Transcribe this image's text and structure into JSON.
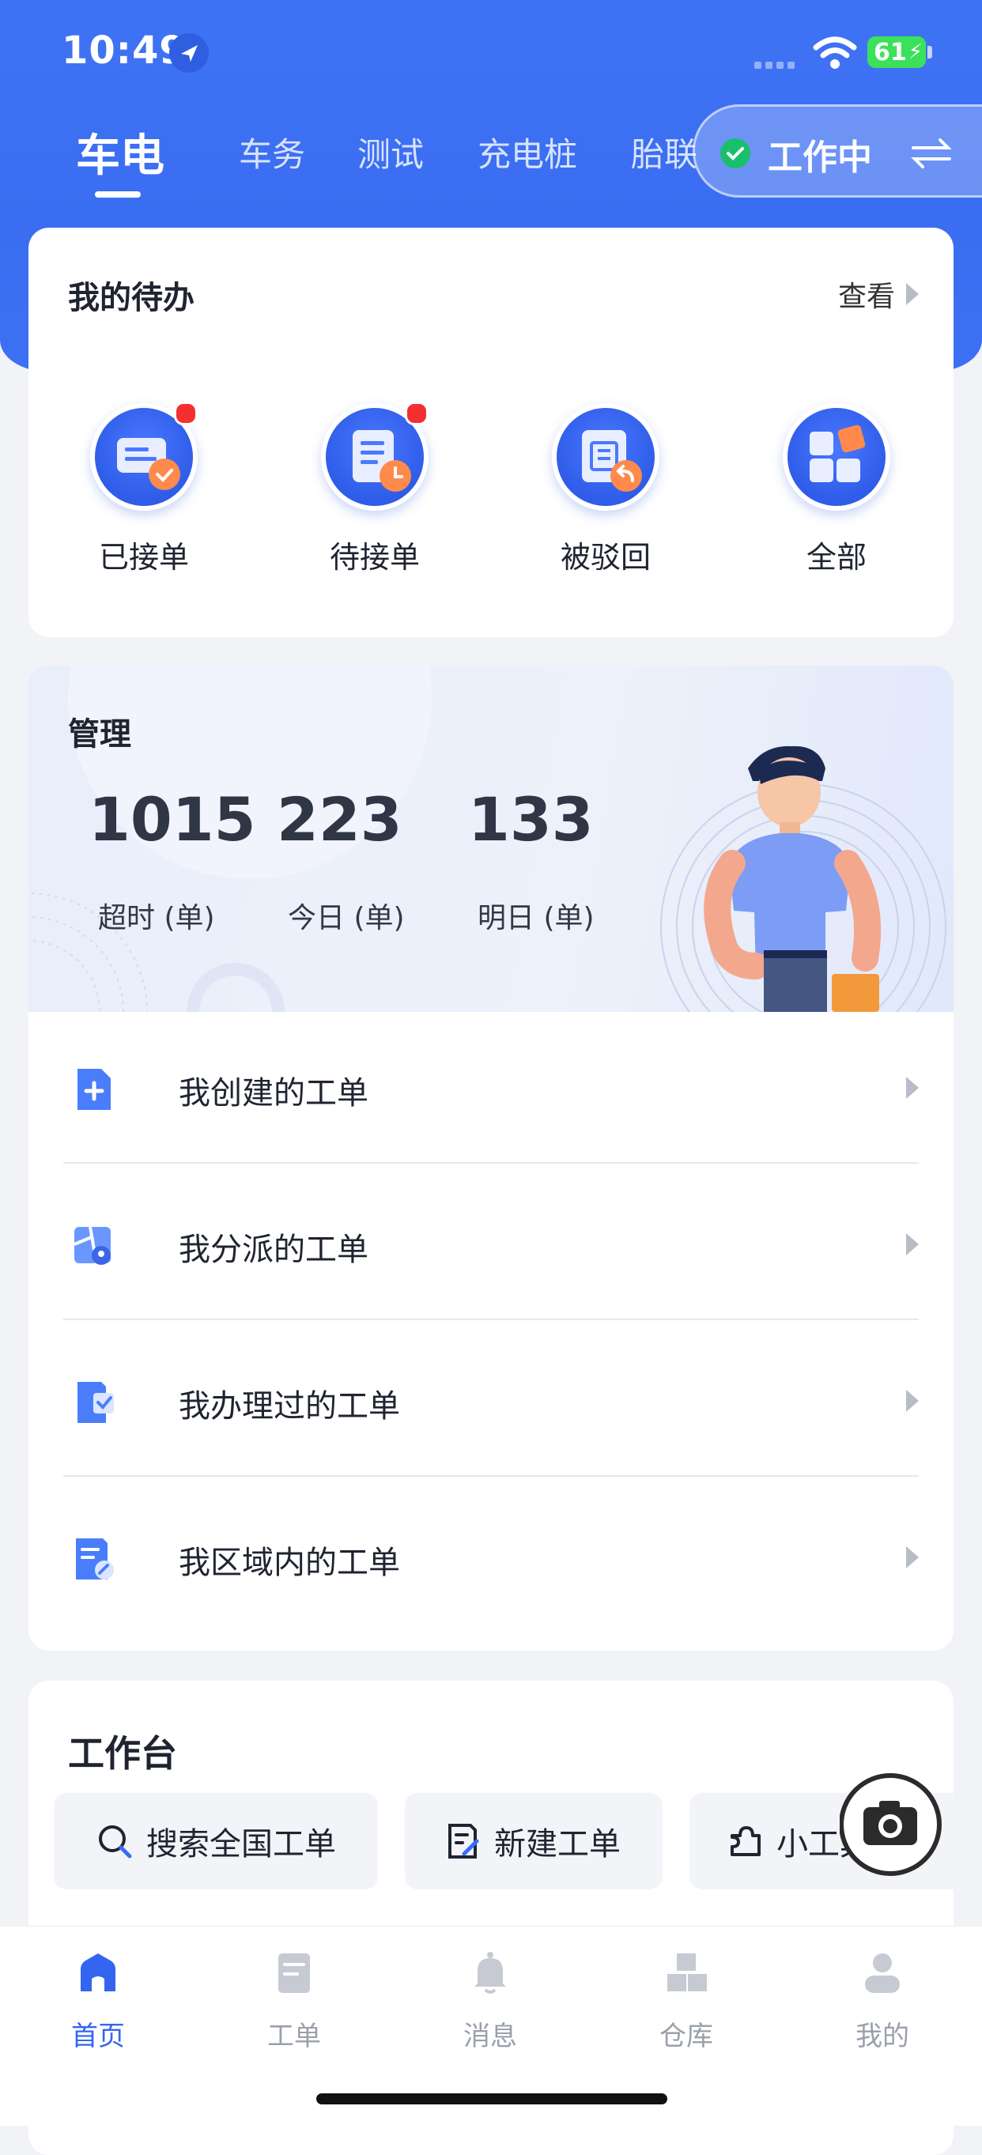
{
  "status_bar": {
    "time": "10:49",
    "battery": "61"
  },
  "top_tabs": {
    "items": [
      "车电",
      "车务",
      "测试",
      "充电桩",
      "胎联"
    ],
    "active": "车电",
    "work_status": "工作中"
  },
  "todo": {
    "title": "我的待办",
    "view_label": "查看",
    "items": [
      {
        "label": "已接单",
        "has_badge": true
      },
      {
        "label": "待接单",
        "has_badge": true
      },
      {
        "label": "被驳回",
        "has_badge": false
      },
      {
        "label": "全部",
        "has_badge": false
      }
    ]
  },
  "management": {
    "title": "管理",
    "stats": [
      {
        "value": "1015",
        "label": "超时 (单)"
      },
      {
        "value": "223",
        "label": "今日 (单)"
      },
      {
        "value": "133",
        "label": "明日 (单)"
      }
    ]
  },
  "order_links": [
    {
      "label": "我创建的工单",
      "icon": "doc-plus-icon"
    },
    {
      "label": "我分派的工单",
      "icon": "dispatch-map-icon"
    },
    {
      "label": "我办理过的工单",
      "icon": "doc-check-icon"
    },
    {
      "label": "我区域内的工单",
      "icon": "doc-region-icon"
    }
  ],
  "workbench": {
    "title": "工作台",
    "buttons": [
      {
        "label": "搜索全国工单",
        "icon": "search-icon"
      },
      {
        "label": "新建工单",
        "icon": "edit-doc-icon"
      },
      {
        "label": "小工具",
        "icon": "puzzle-icon"
      }
    ]
  },
  "bottom_nav": {
    "items": [
      {
        "label": "首页",
        "icon": "home-icon",
        "active": true
      },
      {
        "label": "工单",
        "icon": "order-icon",
        "active": false
      },
      {
        "label": "消息",
        "icon": "bell-icon",
        "active": false
      },
      {
        "label": "仓库",
        "icon": "warehouse-icon",
        "active": false
      },
      {
        "label": "我的",
        "icon": "profile-icon",
        "active": false
      }
    ]
  },
  "colors": {
    "primary": "#3a6df1",
    "badge": "#f42f2f",
    "success": "#19c06b"
  }
}
